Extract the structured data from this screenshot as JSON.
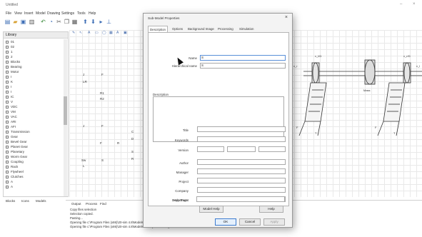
{
  "app": {
    "title": "Untitled"
  },
  "window_controls": {
    "minimize": "–",
    "close": "×"
  },
  "menu": [
    "File",
    "View",
    "Insert",
    "Model",
    "Drawing",
    "Settings",
    "Tools",
    "Help"
  ],
  "library": {
    "header": "Library",
    "items": [
      "01",
      "02",
      "1",
      "2",
      "Blocks",
      "Bearing",
      "Motor",
      "I",
      "K",
      "I",
      "I",
      "IC",
      "V",
      "VDC",
      "VM",
      "VAC",
      "ARI",
      "AFI",
      "Transmission",
      "Gear",
      "Bevel Gear",
      "Planet Gear",
      "Planetary",
      "Worm Gear",
      "Coupling",
      "Rack",
      "Flywheel",
      "Clutches",
      "A",
      "A"
    ]
  },
  "bottom_left_tabs": [
    "Blocks",
    "Icons",
    "Models"
  ],
  "canvas_toolbar": [
    "✎",
    "↖",
    "A",
    "▭",
    "◯",
    "▦",
    "A",
    "▣"
  ],
  "canvas_labels": [
    "J",
    "F",
    "LR",
    "R1",
    "R2",
    "J",
    "F",
    "C",
    "D",
    "F",
    "R",
    "Sw",
    "S",
    "L",
    "S",
    "R"
  ],
  "dialog": {
    "title": "Sub-Model Properties",
    "tabs": [
      "Description",
      "Options",
      "Background Image",
      "Processing",
      "Simulation"
    ],
    "name_label": "Name",
    "name_value": "S",
    "hierarchical_label": "Hierarchical name",
    "hierarchical_value": "S",
    "description_label": "Description",
    "title_label": "Title",
    "keywords_label": "Keywords",
    "version_label": "Version",
    "author_label": "Author",
    "manager_label": "Manager",
    "project_label": "Project",
    "company_label": "Company",
    "department_label": "Department",
    "help_page_label": "Help Page",
    "model_help_btn": "Model Help",
    "help_btn": "Help",
    "ok_btn": "OK",
    "cancel_btn": "Cancel",
    "apply_btn": "Apply"
  },
  "output": {
    "tabs": [
      "Output",
      "Process",
      "Find"
    ],
    "lines": [
      "Copy files selection",
      "Selection copied.",
      "Pasting...",
      "Opening file c:\\Program Files (x86)\\20-sim 4.8\\Models\\Library\\Iconic Diagrams\\Gear.emx",
      "Opening file c:\\Program Files (x86)\\20-sim 4.8\\Models\\Library\\Iconic Diagrams\\Gear.emx"
    ]
  },
  "diagram": {
    "labels": [
      "v_l/Ω",
      "v_r/Ω",
      "Mass",
      "v_r",
      "v_l",
      "F",
      "F",
      "T",
      "T"
    ]
  }
}
